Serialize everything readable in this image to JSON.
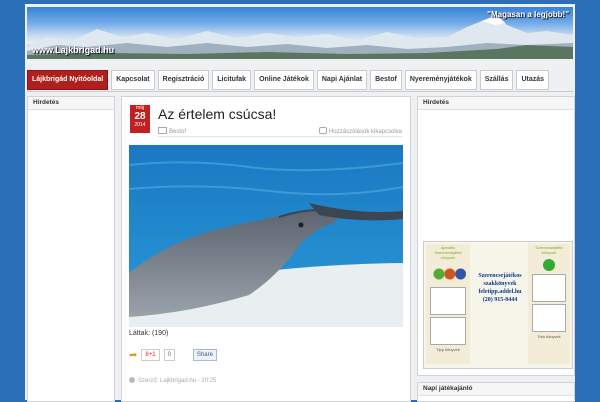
{
  "header": {
    "site_url": "www.Lajkbrigad.hu",
    "slogan": "\"Magasan a legjobb!\""
  },
  "nav": {
    "items": [
      {
        "label": "Lájkbrigád Nyitóoldal",
        "active": true
      },
      {
        "label": "Kapcsolat",
        "active": false
      },
      {
        "label": "Regisztráció",
        "active": false
      },
      {
        "label": "Licitufak",
        "active": false
      },
      {
        "label": "Online Játékok",
        "active": false
      },
      {
        "label": "Napi Ajánlat",
        "active": false
      },
      {
        "label": "Bestof",
        "active": false
      },
      {
        "label": "Nyereményjátékok",
        "active": false
      },
      {
        "label": "Szállás",
        "active": false
      },
      {
        "label": "Utazás",
        "active": false
      }
    ]
  },
  "left_sidebar": {
    "title": "Hirdetés"
  },
  "right_sidebar": {
    "title": "Hirdetés",
    "bottom_title": "Napi játékajánló",
    "ad": {
      "left_header": "Ajándék Szerencsejáték könyvek",
      "center_line1": "Szerencsejátékos",
      "center_line2": "szakkönyvek",
      "center_line3": "feletipp.addel.hu",
      "center_line4": "(20) 915-8444",
      "right_header": "Szerencsejáték könyvek",
      "bottom_left": "Tipp könyvek",
      "bottom_right": "Totó könyvek"
    }
  },
  "post": {
    "date_month": "máj",
    "date_day": "28",
    "date_year": "2014",
    "title": "Az értelem csúcsa!",
    "category": "Bestof",
    "comments_link": "Hozzászólások kikapcsolva",
    "views": "Láttak: (190)",
    "gplus_label": "8+1",
    "gplus_count": "0",
    "share_label": "Share",
    "footer": "Szerző: Lajkbrigad.hu - 20:25"
  },
  "colors": {
    "background": "#2a6fb8",
    "nav_active": "#b01e1e",
    "date_box": "#c02020"
  }
}
